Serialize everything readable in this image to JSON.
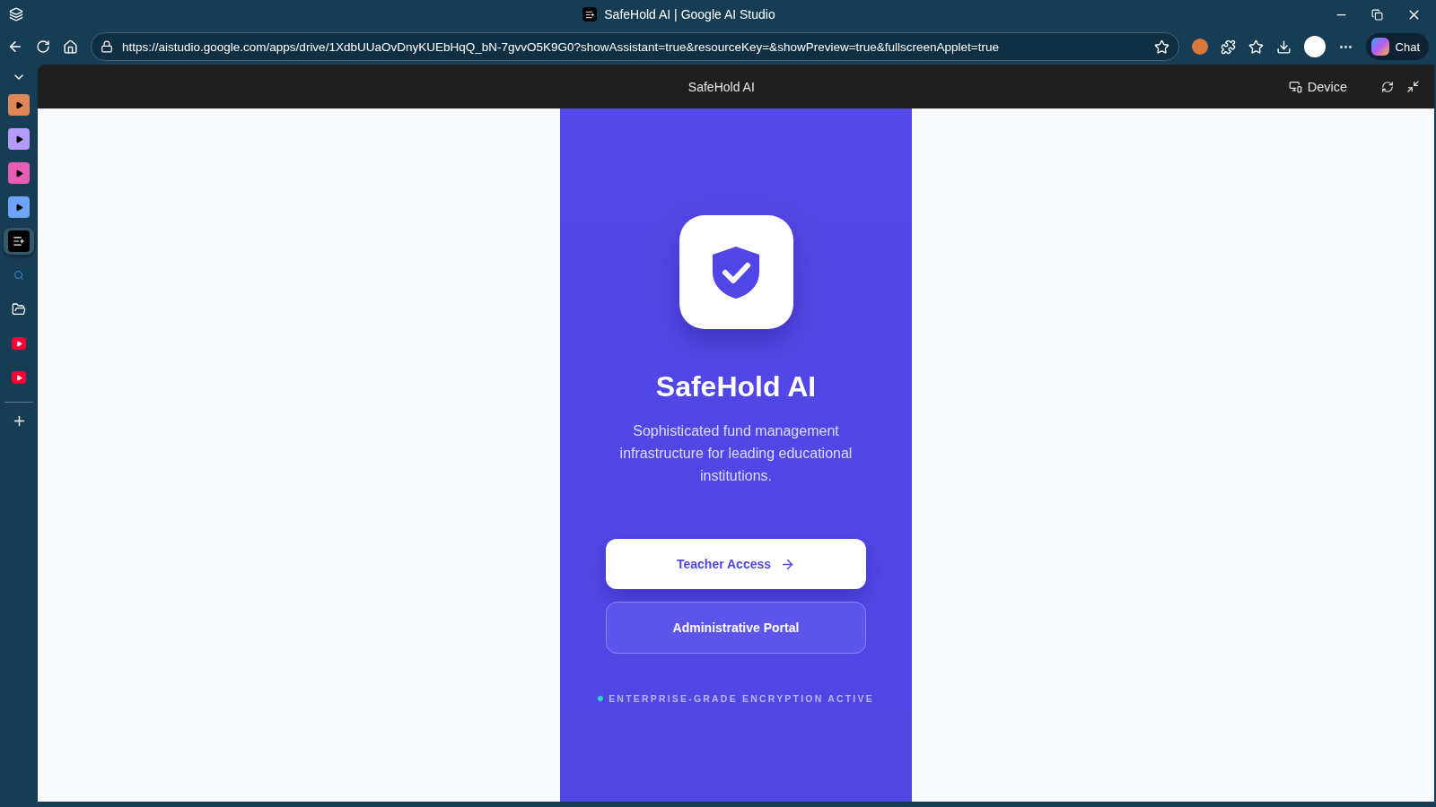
{
  "window": {
    "title": "SafeHold AI | Google AI Studio"
  },
  "address_bar": {
    "url": "https://aistudio.google.com/apps/drive/1XdbUUaOvDnyKUEbHqQ_bN-7gvvO5K9G0?showAssistant=true&resourceKey=&showPreview=true&fullscreenApplet=true"
  },
  "chat_button": {
    "label": "Chat"
  },
  "vertical_tabs": [
    {
      "kind": "media",
      "color": "#e0875a",
      "selected": false
    },
    {
      "kind": "media",
      "color": "#b59cfb",
      "selected": false
    },
    {
      "kind": "media",
      "color": "#e85cb5",
      "selected": false
    },
    {
      "kind": "media",
      "color": "#6ea4f7",
      "selected": false
    },
    {
      "kind": "studio",
      "selected": true
    },
    {
      "kind": "search",
      "selected": false
    },
    {
      "kind": "folder",
      "selected": false
    },
    {
      "kind": "video",
      "selected": false
    },
    {
      "kind": "video",
      "selected": false
    }
  ],
  "applet_header": {
    "title": "SafeHold AI",
    "device_label": "Device"
  },
  "app": {
    "title": "SafeHold AI",
    "description": "Sophisticated fund management infrastructure for leading educational institutions.",
    "buttons": [
      {
        "kind": "primary",
        "label": "Teacher Access"
      },
      {
        "kind": "secondary",
        "label": "Administrative Portal"
      }
    ],
    "status": {
      "label": "ENTERPRISE-GRADE ENCRYPTION ACTIVE",
      "color": "#2dd4bf"
    }
  }
}
